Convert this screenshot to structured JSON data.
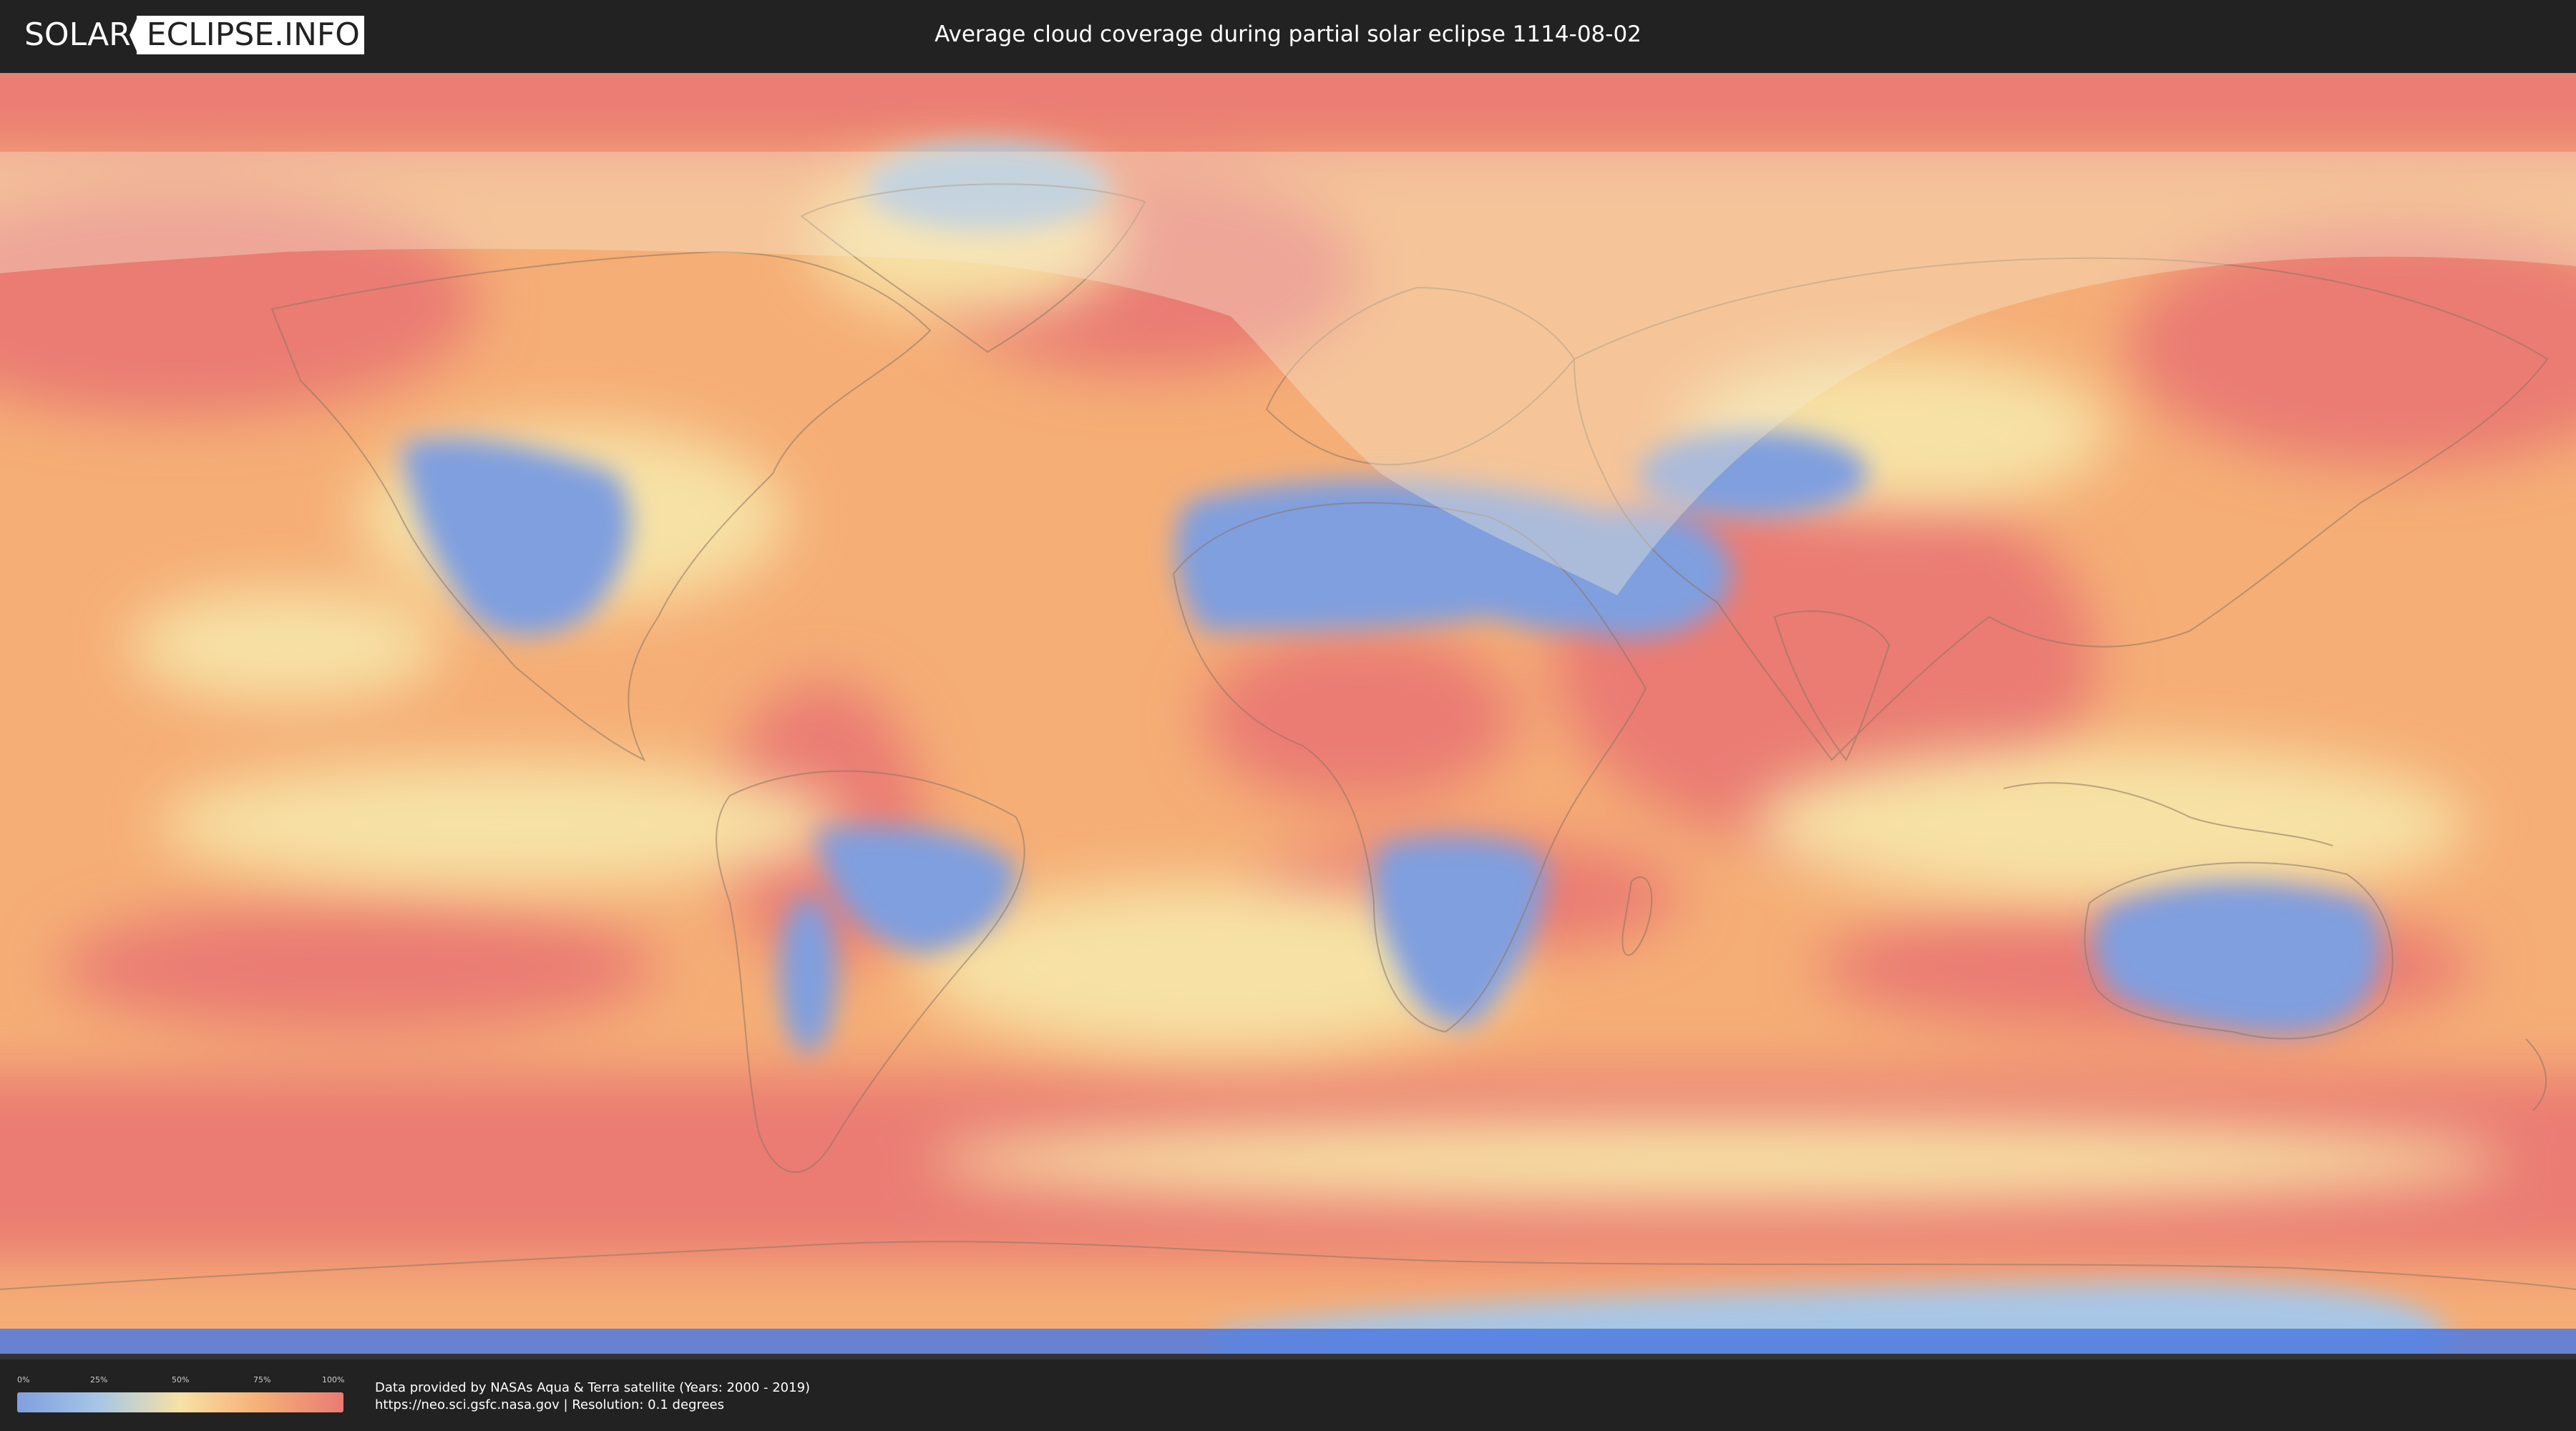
{
  "header": {
    "logo_part1": "SOLAR",
    "logo_part2": "ECLIPSE.INFO",
    "title": "Average cloud coverage during partial solar eclipse 1114-08-02"
  },
  "map": {
    "colors": {
      "clear": "#7f9fdf",
      "low": "#a7c6e6",
      "mid": "#f7e1a4",
      "high": "#f5ae76",
      "overcast": "#ea7b73",
      "outline": "#8a7462",
      "eclipse_shade": "#f4ead2",
      "bottom_band": "#4d7ae0"
    }
  },
  "legend": {
    "ticks": [
      "0%",
      "25%",
      "50%",
      "75%",
      "100%"
    ],
    "gradient_colors": [
      "#7f9fdf",
      "#a7c6e6",
      "#f7e1a4",
      "#f5ae76",
      "#ea7b73"
    ]
  },
  "attribution": {
    "line1": "Data provided by NASAs Aqua & Terra satellite (Years: 2000 - 2019)",
    "line2": "https://neo.sci.gsfc.nasa.gov | Resolution: 0.1 degrees"
  }
}
